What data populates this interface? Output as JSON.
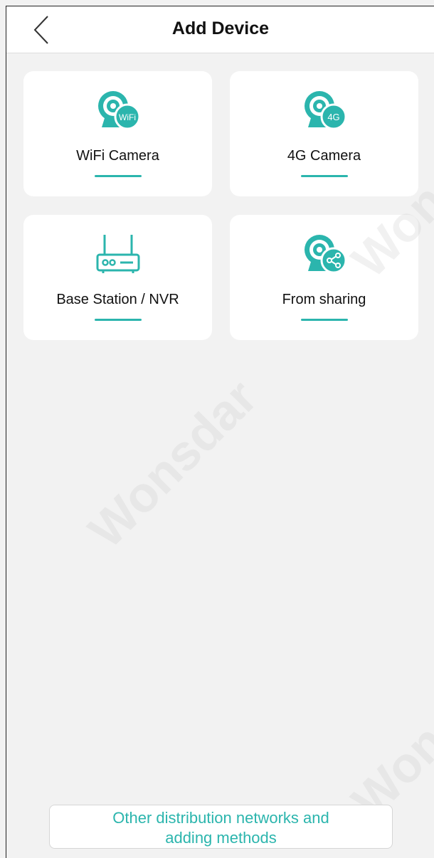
{
  "header": {
    "title": "Add Device"
  },
  "cards": [
    {
      "label": "WiFi Camera",
      "icon": "wifi-camera-icon",
      "badge": "WiFi"
    },
    {
      "label": "4G Camera",
      "icon": "4g-camera-icon",
      "badge": "4G"
    },
    {
      "label": "Base Station / NVR",
      "icon": "base-station-icon"
    },
    {
      "label": "From sharing",
      "icon": "share-camera-icon"
    }
  ],
  "bottom": {
    "line1": "Other distribution networks and",
    "line2": "adding methods"
  },
  "watermark": "Wonsdar",
  "colors": {
    "accent": "#2bb5ad",
    "background": "#f2f2f2"
  }
}
